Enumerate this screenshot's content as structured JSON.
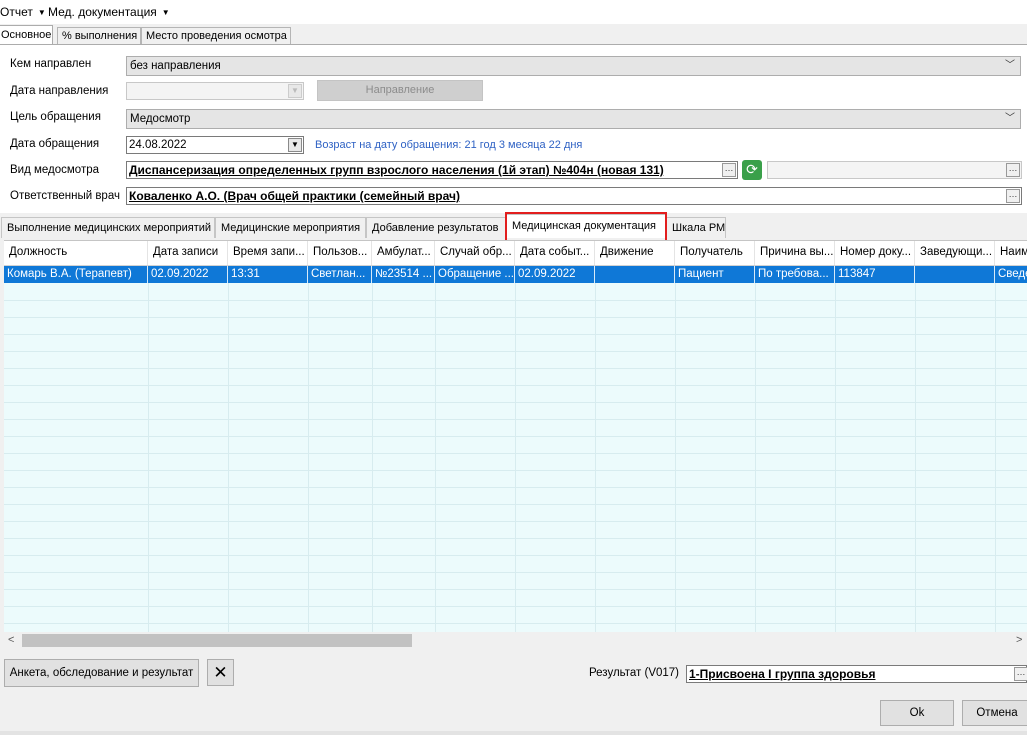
{
  "menu": {
    "report": "Отчет",
    "med_docs": "Мед. документация"
  },
  "top_tabs": {
    "main": "Основное",
    "percent": "% выполнения",
    "place": "Место проведения осмотра"
  },
  "form": {
    "referred_by_label": "Кем направлен",
    "referred_by_value": "без направления",
    "referral_date_label": "Дата направления",
    "referral_button": "Направление",
    "purpose_label": "Цель обращения",
    "purpose_value": "Медосмотр",
    "visit_date_label": "Дата обращения",
    "visit_date_value": "24.08.2022",
    "age_text": "Возраст на дату обращения:  21 год 3 месяца 22 дня",
    "exam_type_label": "Вид медосмотра",
    "exam_type_value": "Диспансеризация определенных групп взрослого населения (1й этап) №404н (новая 131)",
    "doctor_label": "Ответственный врач",
    "doctor_value": "Коваленко А.О. (Врач общей практики (семейный врач)"
  },
  "sub_tabs": {
    "t1": "Выполнение медицинских мероприятий",
    "t2": "Медицинские мероприятия",
    "t3": "Добавление результатов",
    "t4": "Медицинская документация",
    "t5": "Шкала РМ"
  },
  "grid": {
    "headers": [
      "Должность",
      "Дата записи",
      "Время запи...",
      "Пользов...",
      "Амбулат...",
      "Случай обр...",
      "Дата событ...",
      "Движение",
      "Получатель",
      "Причина вы...",
      "Номер доку...",
      "Заведующи...",
      "Наим"
    ],
    "row": [
      "Комарь В.А. (Терапевт)",
      "02.09.2022",
      "13:31",
      "Светлан...",
      "№23514 ...",
      "Обращение ...",
      "02.09.2022",
      "",
      "Пациент",
      "По требова...",
      "113847",
      "",
      "Сведе"
    ]
  },
  "bottom": {
    "survey_button": "Анкета, обследование и результат",
    "result_label": "Результат (V017)",
    "result_value": "1-Присвоена I группа здоровья",
    "ok": "Ok",
    "cancel": "Отмена"
  }
}
